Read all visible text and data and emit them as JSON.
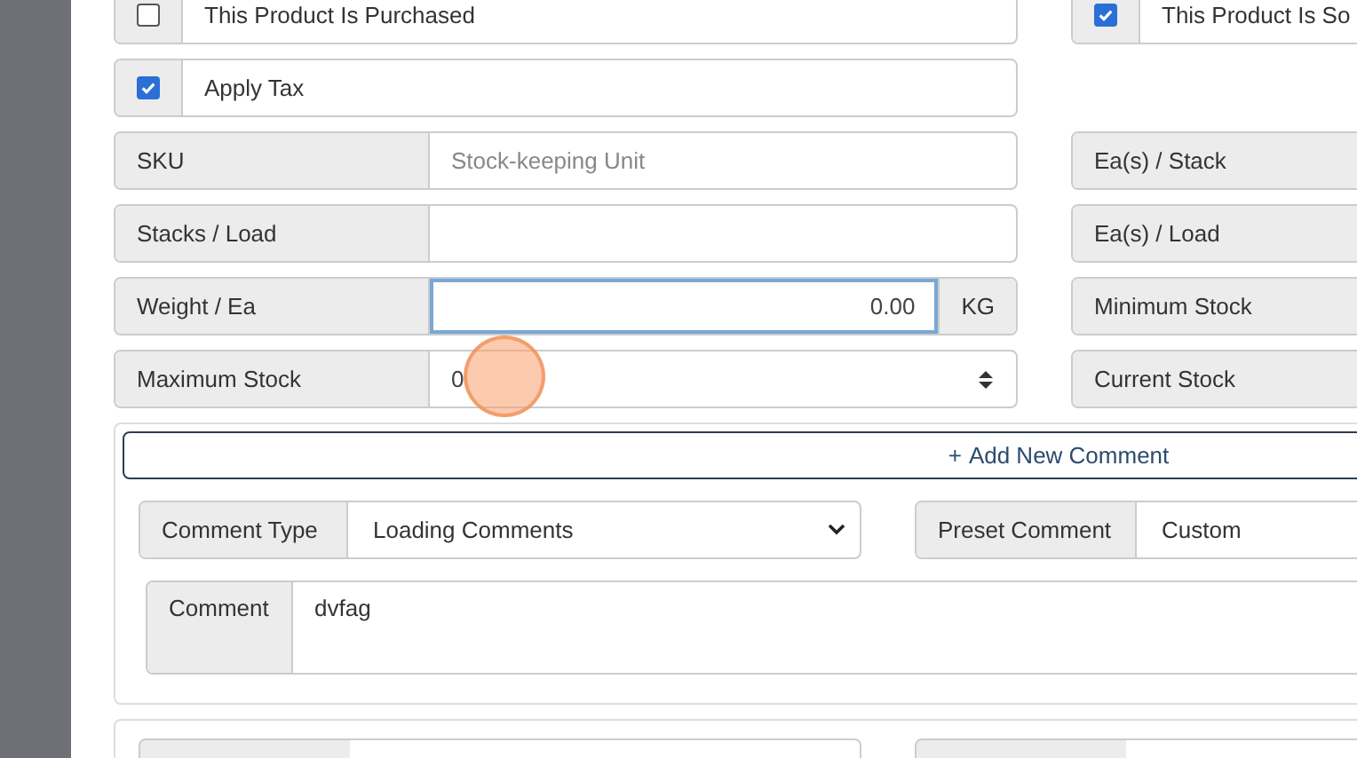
{
  "rows": [
    {
      "left": {
        "kind": "checkbox",
        "label": "This Product Is Purchased",
        "checked": false
      },
      "right": {
        "kind": "checkbox",
        "label": "This Product Is So",
        "checked": true
      }
    },
    {
      "left": {
        "kind": "checkbox",
        "label": "Apply Tax",
        "checked": true
      }
    },
    {
      "left": {
        "kind": "text",
        "label": "SKU",
        "placeholder": "Stock-keeping Unit",
        "focused": false
      },
      "right": {
        "kind": "text",
        "label": "Ea(s) / Stack"
      }
    },
    {
      "left": {
        "kind": "text",
        "label": "Stacks / Load",
        "focused": false
      },
      "right": {
        "kind": "text",
        "label": "Ea(s) / Load"
      }
    },
    {
      "left": {
        "kind": "text",
        "label": "Weight / Ea",
        "value": "0.00",
        "unit": "KG",
        "focused": true
      },
      "right": {
        "kind": "text",
        "label": "Minimum Stock"
      }
    },
    {
      "left": {
        "kind": "number",
        "label": "Maximum Stock",
        "value": "0",
        "focused": false
      },
      "right": {
        "kind": "text",
        "label": "Current Stock"
      }
    }
  ],
  "add_comment_button": {
    "icon": "+",
    "label": "Add New Comment"
  },
  "comments": [
    {
      "type_label": "Comment Type",
      "type_value": "Loading Comments",
      "preset_label": "Preset Comment",
      "preset_value": "Custom",
      "comment_label": "Comment",
      "comment_value": "dvfag"
    }
  ]
}
